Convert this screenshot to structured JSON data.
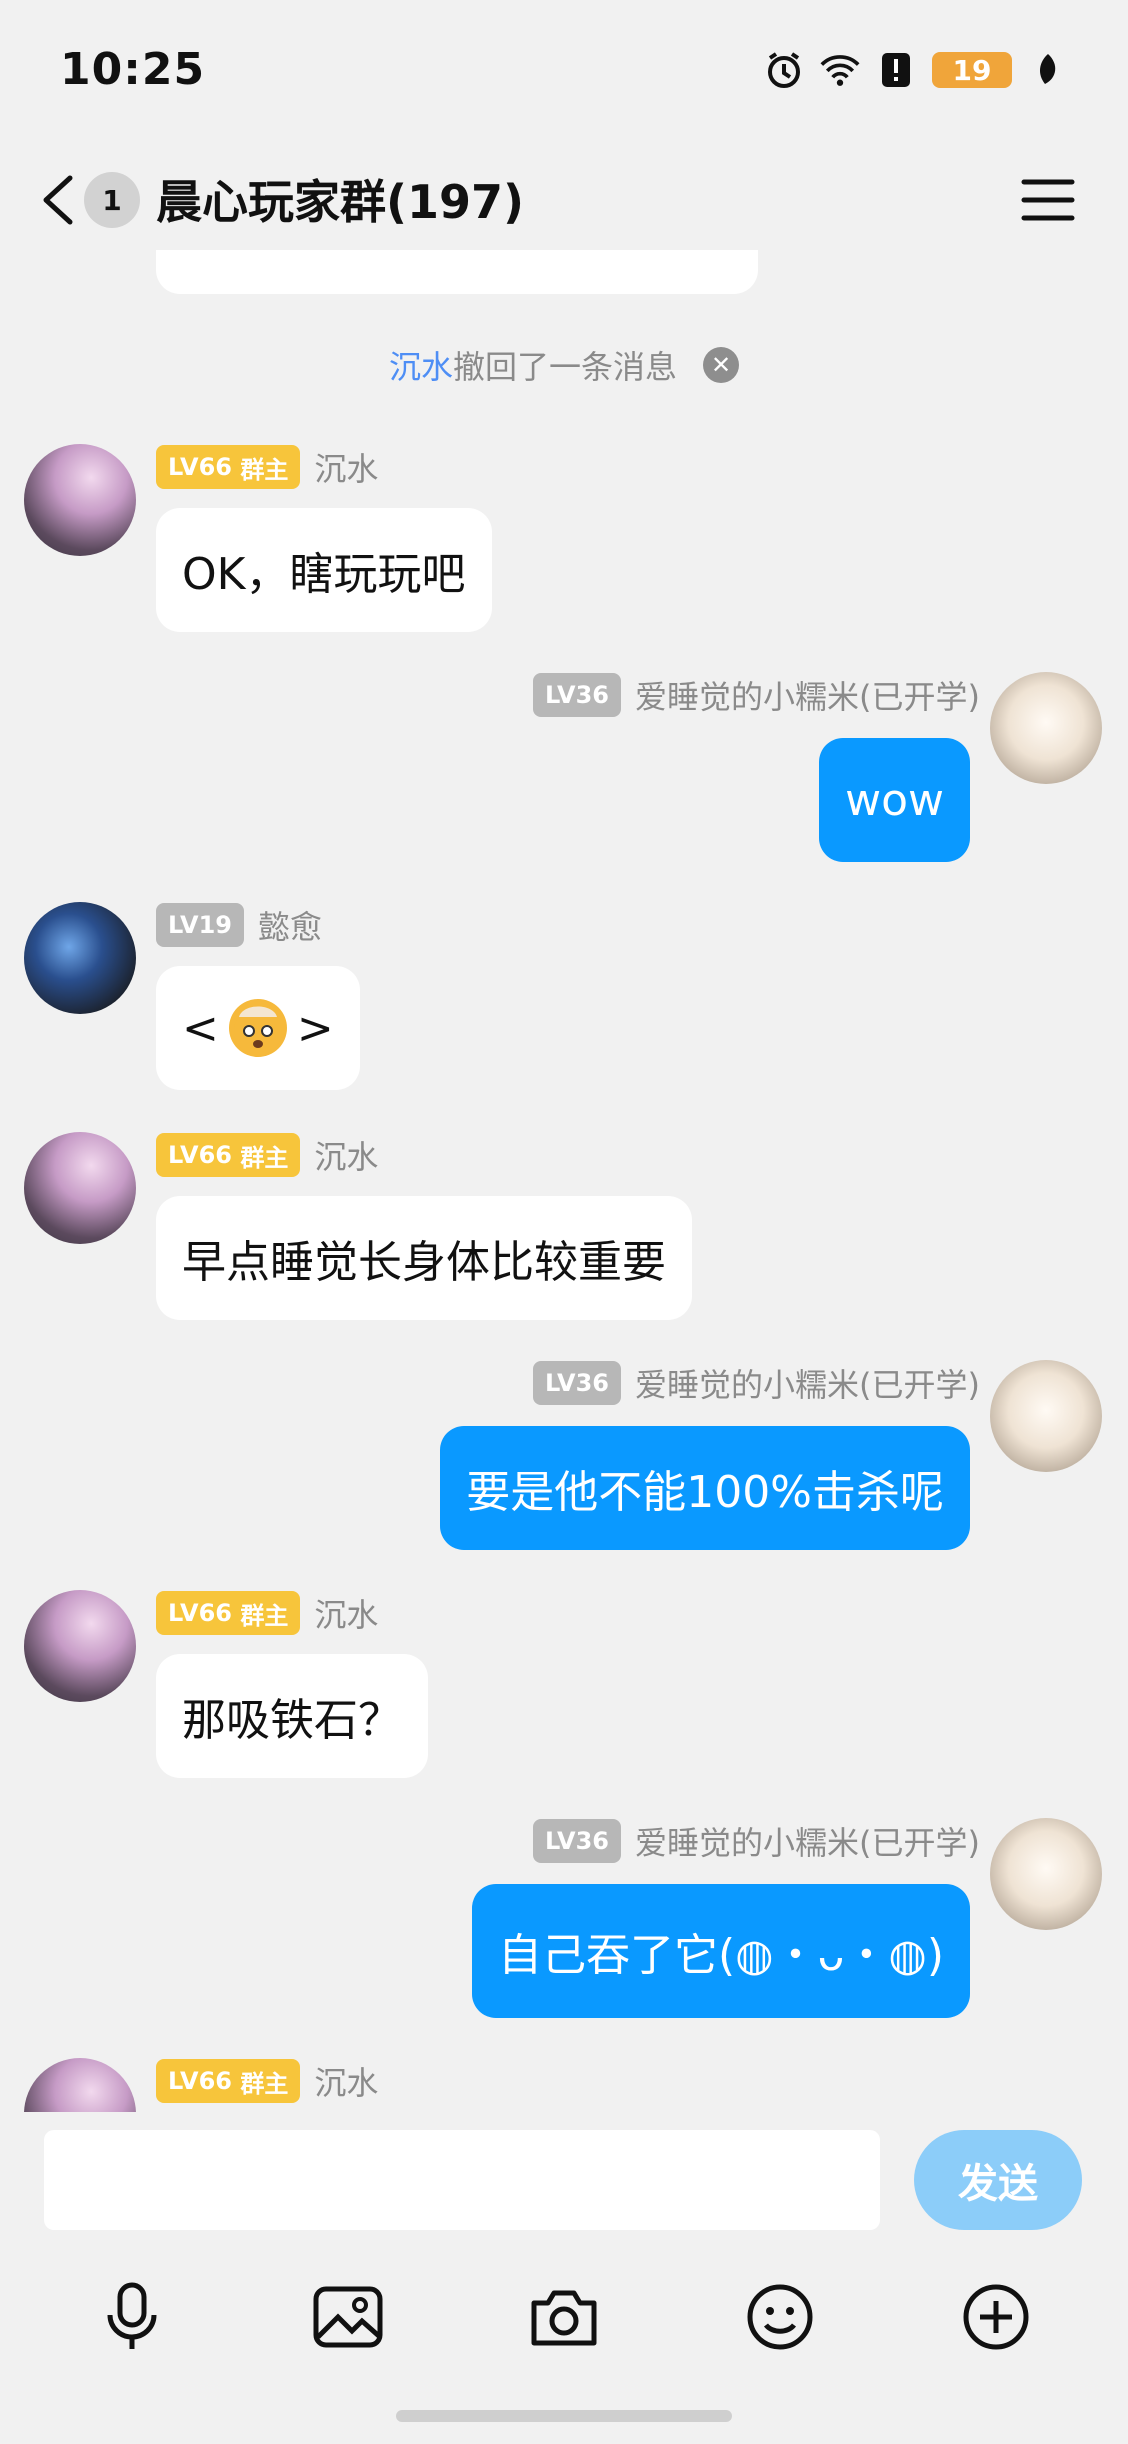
{
  "status_bar": {
    "time": "10:25",
    "battery": "19"
  },
  "header": {
    "unread_count": "1",
    "title": "晨心玩家群(197)"
  },
  "system_notice": {
    "who": "沉水",
    "text": "撤回了一条消息"
  },
  "messages": [
    {
      "side": "left",
      "level": "LV66",
      "role": "群主",
      "name": "沉水",
      "text": "OK，瞎玩玩吧"
    },
    {
      "side": "right",
      "level": "LV36",
      "name": "爱睡觉的小糯米(已开学)",
      "text": "wow"
    },
    {
      "side": "left",
      "level": "LV19",
      "name": "懿愈",
      "text_left": "<",
      "text_right": ">",
      "emoji": "exploding-head"
    },
    {
      "side": "left",
      "level": "LV66",
      "role": "群主",
      "name": "沉水",
      "text": "早点睡觉长身体比较重要"
    },
    {
      "side": "right",
      "level": "LV36",
      "name": "爱睡觉的小糯米(已开学)",
      "text": "要是他不能100%击杀呢"
    },
    {
      "side": "left",
      "level": "LV66",
      "role": "群主",
      "name": "沉水",
      "text": "那吸铁石？"
    },
    {
      "side": "right",
      "level": "LV36",
      "name": "爱睡觉的小糯米(已开学)",
      "text": "自己吞了它(◍・ᴗ・◍)"
    },
    {
      "side": "left",
      "level": "LV66",
      "role": "群主",
      "name": "沉水"
    }
  ],
  "input": {
    "placeholder": "",
    "send_label": "发送"
  },
  "toolbar": {
    "items": [
      "microphone-icon",
      "image-icon",
      "camera-icon",
      "emoji-icon",
      "plus-icon"
    ]
  }
}
